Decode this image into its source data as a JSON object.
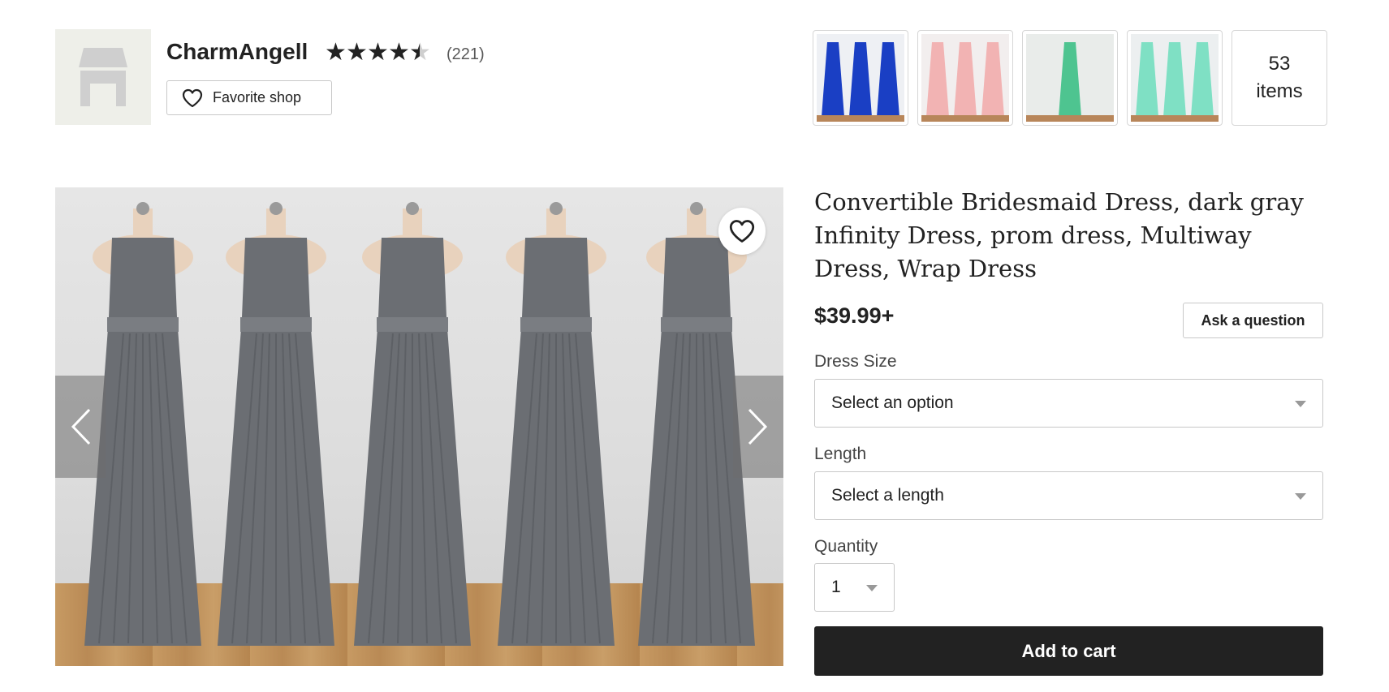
{
  "shop": {
    "name": "CharmAngell",
    "rating": 4.5,
    "stars": [
      "★",
      "★",
      "★",
      "★",
      "★"
    ],
    "reviews": "(221)",
    "favorite_label": "Favorite shop",
    "thumbnails": [
      {
        "name": "blue-dresses",
        "color": "#1a3fc4",
        "bg": "#eef0f4"
      },
      {
        "name": "pink-dresses",
        "color": "#f2b3b3",
        "bg": "#f2eeee"
      },
      {
        "name": "green-dress",
        "color": "#4ec490",
        "bg": "#e9ecea"
      },
      {
        "name": "mint-dresses",
        "color": "#7fe0c4",
        "bg": "#eceff0"
      }
    ],
    "items_count": "53",
    "items_label": "items"
  },
  "gallery": {
    "dress_color": "#6b6e73",
    "dress_count": 5
  },
  "listing": {
    "title": "Convertible Bridesmaid Dress, dark gray Infinity Dress, prom dress, Multiway Dress, Wrap Dress",
    "price": "$39.99+",
    "ask_label": "Ask a question",
    "dress_size": {
      "label": "Dress Size",
      "value": "Select an option"
    },
    "length": {
      "label": "Length",
      "value": "Select a length"
    },
    "quantity": {
      "label": "Quantity",
      "value": "1"
    },
    "add_to_cart": "Add to cart"
  }
}
